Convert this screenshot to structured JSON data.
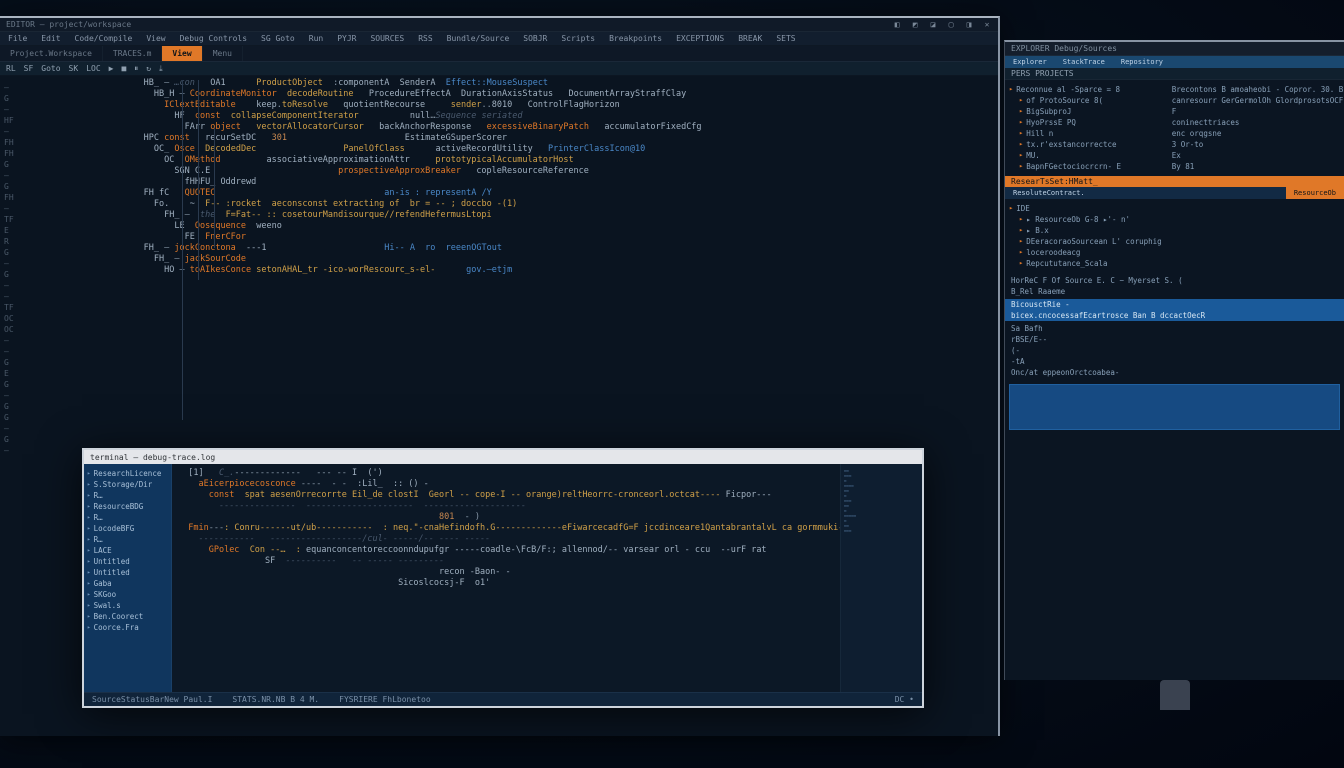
{
  "main_window": {
    "titlebar": {
      "left": "EDITOR — project/workspace"
    },
    "system_icons": [
      "◧",
      "◩",
      "◪",
      "▢",
      "◨",
      "✕"
    ],
    "menubar": [
      "File",
      "Edit",
      "Code/Compile",
      "View",
      "Debug Controls",
      "SG Goto",
      "Run",
      "PYJR",
      "SOURCES",
      "RSS",
      "Bundle/Source",
      "SOBJR",
      "Scripts",
      "Breakpoints",
      "EXCEPTIONS",
      "BREAK",
      "SETS"
    ],
    "tabs": [
      {
        "label": "Project.Workspace",
        "active": false
      },
      {
        "label": "TRACES.m",
        "active": false
      },
      {
        "label": "View",
        "active": true
      },
      {
        "label": "Menu",
        "active": false
      }
    ],
    "toolbar": [
      "RL",
      "SF",
      "Goto",
      "SK",
      "LOC",
      "▶",
      "■",
      "⏸",
      "↻",
      "⤓"
    ],
    "gutter": [
      "—",
      "G",
      "—",
      "HF",
      "—",
      "FH",
      "FH",
      "G",
      "—",
      "G",
      "FH",
      "—",
      "TF",
      "E",
      "R",
      "G",
      "—",
      "G",
      "—",
      "—",
      "TF",
      "OC",
      "OC",
      "—",
      "—",
      "G",
      "E",
      "G",
      "—",
      "G",
      "G",
      "—",
      "G",
      "—"
    ],
    "code_lines": [
      [
        [
          "id",
          "HB_"
        ],
        [
          "op",
          " — "
        ],
        [
          "cm",
          "…con"
        ],
        [
          "op",
          "   "
        ],
        [
          "id",
          "OA1"
        ],
        [
          "op",
          "      "
        ],
        [
          "fn",
          "ProductObject"
        ],
        [
          "op",
          "  :"
        ],
        [
          "id",
          "componentA"
        ],
        [
          "op",
          "  "
        ],
        [
          "id",
          "SenderA"
        ],
        [
          "op",
          "  "
        ],
        [
          "typ",
          "Effect::MouseSuspect"
        ]
      ],
      [
        [
          "id",
          "HB_H"
        ],
        [
          "op",
          " — "
        ],
        [
          "kw",
          "CoordinateMonitor"
        ],
        [
          "op",
          "  "
        ],
        [
          "fn",
          "decodeRoutine"
        ],
        [
          "op",
          "   "
        ],
        [
          "id",
          "ProcedureEffectA"
        ],
        [
          "op",
          "  "
        ],
        [
          "id",
          "DurationAxisStatus"
        ],
        [
          "op",
          "   "
        ],
        [
          "id",
          "DocumentArrayStraffClay"
        ]
      ],
      [
        [
          "kw",
          "IClextEditable"
        ],
        [
          "op",
          "    "
        ],
        [
          "id",
          "keep"
        ],
        [
          "op",
          "."
        ],
        [
          "fn",
          "toResolve"
        ],
        [
          "op",
          "   "
        ],
        [
          "id",
          "quotientRecourse"
        ],
        [
          "op",
          "     "
        ],
        [
          "fn",
          "sender"
        ],
        [
          "op",
          ".."
        ],
        [
          "id",
          "8010"
        ],
        [
          "op",
          "   "
        ],
        [
          "id",
          "ControlFlagHorizon"
        ]
      ],
      [
        [
          "id",
          "HF"
        ],
        [
          "op",
          "  "
        ],
        [
          "kw",
          "const"
        ],
        [
          "op",
          "  "
        ],
        [
          "fn",
          "collapseComponentIterator"
        ],
        [
          "op",
          "          "
        ],
        [
          "id",
          "null"
        ],
        [
          "op",
          "…"
        ],
        [
          "cm",
          "Sequence seriated"
        ]
      ],
      [
        [
          "id",
          "FArr"
        ],
        [
          "op",
          " "
        ],
        [
          "kw",
          "object"
        ],
        [
          "op",
          "   "
        ],
        [
          "fn",
          "vectorAllocatorCursor"
        ],
        [
          "op",
          "   "
        ],
        [
          "id",
          "backAnchorResponse"
        ],
        [
          "op",
          "   "
        ],
        [
          "kw",
          "excessiveBinaryPatch"
        ],
        [
          "op",
          "   "
        ],
        [
          "id",
          "accumulatorFixedCfg"
        ]
      ],
      [
        [
          "id",
          "HPC"
        ],
        [
          "op",
          " "
        ],
        [
          "kw",
          "const"
        ],
        [
          "op",
          "   "
        ],
        [
          "id",
          "recurSetDC"
        ],
        [
          "op",
          "   "
        ],
        [
          "num",
          "301"
        ],
        [
          "op",
          "                       "
        ],
        [
          "id",
          "EstimateGSuperScorer"
        ]
      ],
      [
        [
          "id",
          "OC"
        ],
        [
          "op",
          "_ "
        ],
        [
          "kw",
          "Osce"
        ],
        [
          "op",
          "  "
        ],
        [
          "fn",
          "DecodedDec"
        ],
        [
          "op",
          "                 "
        ],
        [
          "fn",
          "PanelOfClass"
        ],
        [
          "op",
          "      "
        ],
        [
          "id",
          "activeRecordUtility"
        ],
        [
          "op",
          "   "
        ],
        [
          "typ",
          "PrinterClassIcon@10"
        ]
      ],
      [
        [
          "id",
          "OC"
        ],
        [
          "op",
          "  "
        ],
        [
          "kw",
          "OMethod"
        ],
        [
          "op",
          "         "
        ],
        [
          "id",
          "associativeApproximationAttr"
        ],
        [
          "op",
          "     "
        ],
        [
          "fn",
          "prototypicalAccumulatorHost"
        ]
      ],
      [
        [
          "id",
          "SGN C.E"
        ],
        [
          "op",
          "                         "
        ],
        [
          "kw",
          "prospectiveApproxBreaker"
        ],
        [
          "op",
          "   "
        ],
        [
          "id",
          "copleResourceReference"
        ]
      ],
      [
        [
          "id",
          "fHHFU_"
        ],
        [
          "op",
          " "
        ],
        [
          "id",
          "Oddrewd"
        ]
      ],
      [
        [
          "id",
          "FH fC"
        ],
        [
          "op",
          "   "
        ],
        [
          "kw",
          "QUOTEC"
        ],
        [
          "op",
          "                                 "
        ],
        [
          "typ",
          "an-is : representA /Y"
        ]
      ],
      [
        [
          "id",
          "Fo."
        ],
        [
          "op",
          "    "
        ],
        [
          "id",
          "~"
        ],
        [
          "op",
          "  "
        ],
        [
          "fn",
          "F-- :rocket  aeconsconst extracting of  br = -- ; doccbo -(1)"
        ]
      ],
      [
        [
          "id",
          "FH_"
        ],
        [
          "op",
          " — "
        ],
        [
          "cm",
          " the  "
        ],
        [
          "fn",
          "F=Fat-- :: cosetourMandisourque//refendHefermusLtopi"
        ]
      ],
      [
        [
          "id",
          "LE"
        ],
        [
          "op",
          "  "
        ],
        [
          "kw",
          "Qosequence"
        ],
        [
          "op",
          "  "
        ],
        [
          "id",
          "weeno"
        ]
      ],
      [
        [
          "id",
          "FE"
        ],
        [
          "op",
          "  "
        ],
        [
          "kw",
          "FnerCFor"
        ]
      ],
      [
        [
          "id",
          "FH_"
        ],
        [
          "op",
          " — "
        ],
        [
          "kw",
          "jockConctona"
        ],
        [
          "op",
          "  "
        ],
        [
          "id",
          "---1"
        ],
        [
          "op",
          "                       "
        ],
        [
          "typ",
          "Hi-- A  ro  reeenOGTout"
        ]
      ],
      [
        [
          "id",
          "FH_"
        ],
        [
          "op",
          " — "
        ],
        [
          "kw",
          "jackSourCode"
        ]
      ],
      [
        [
          "id",
          "HO"
        ],
        [
          "op",
          " — "
        ],
        [
          "kw",
          "toAIkesConce"
        ],
        [
          "op",
          " "
        ],
        [
          "fn",
          "setonAHAL_tr -ico-worRescourc_s-el-"
        ],
        [
          "op",
          "      "
        ],
        [
          "typ",
          "gov.—etjm"
        ]
      ]
    ]
  },
  "sub_window": {
    "title": "terminal — debug-trace.log",
    "sidebar_items": [
      "ResearchLicence",
      "S.Storage/Dir",
      "R…",
      "ResourceBDG",
      "R…",
      "LocodeBFG",
      "R…",
      "LACE",
      "Untitled",
      "Untitled",
      "Gaba",
      "SKGoo",
      "Swal.s",
      "Ben.Coorect",
      "Coorce.Fra"
    ],
    "code_lines": [
      [
        [
          "id",
          "[1]"
        ],
        [
          "op",
          "   "
        ],
        [
          "cm",
          "C_."
        ],
        [
          "op",
          "-------------   --- -- "
        ],
        [
          "id",
          "I  (')"
        ]
      ],
      [
        [
          "kw",
          "aEicerpiocecosconce"
        ],
        [
          "op",
          " ----  - - "
        ],
        [
          "id",
          " :Lil_  :: () -"
        ]
      ],
      [
        [
          "kw",
          "const"
        ],
        [
          "op",
          "  "
        ],
        [
          "fn",
          "spat aesenOrrecorrte Eil_de clostI  Georl -- cope-I -- orange)reltHeorrc-cronceorl.octcat----"
        ],
        [
          "id",
          " Ficpor---"
        ]
      ],
      [
        [
          "cm",
          "---------------  ---------------------  --------------------"
        ]
      ],
      [
        [
          "op",
          "                                         "
        ],
        [
          "num",
          "801"
        ],
        [
          "op",
          "  - )"
        ]
      ],
      [
        [
          "kw",
          "Fmin"
        ],
        [
          "op",
          "---"
        ],
        [
          "fn",
          ": Conru------ut/ub-----------  : neq.\"-cnaHefindofh.G-------------eFiwarcecadfG=F jccdinceare1QantabrantalvL ca gormmuki----"
        ]
      ],
      [
        [
          "cm",
          "-----------   ------------------/cul- -----/-- ---- -----"
        ]
      ],
      [
        [
          "kw",
          "GPolec"
        ],
        [
          "op",
          "  "
        ],
        [
          "fn",
          "Con --…  : "
        ],
        [
          "id",
          "equanconcentoreccoonndupufgr -----coadle-\\FcB/F:; allennod/-- varsear orl - ccu  --urF rat"
        ]
      ],
      [
        [
          "op",
          "         "
        ],
        [
          "id",
          "SF  "
        ],
        [
          "cm",
          "----------   -- ----- ---------"
        ]
      ],
      [
        [
          "op",
          "                                         "
        ],
        [
          "id",
          "recon -Baon- -"
        ]
      ],
      [
        [
          "op",
          "                                         "
        ],
        [
          "id",
          "Sicoslcocsj-F  o1'"
        ]
      ]
    ],
    "minimap_items": [
      "▬▬",
      "▬▬▬",
      "▬",
      "▬▬▬▬",
      "▬▬",
      "▬",
      "▬▬▬",
      "▬▬",
      "▬",
      "▬▬▬▬▬",
      "▬",
      "▬▬",
      "▬▬▬"
    ],
    "status": {
      "left": "SourceStatusBarNew Paul.I",
      "center": "STATS.NR.NB  B 4 M.",
      "center2": "FYSRIERE   FhLbonetoo",
      "right": "DC  •"
    }
  },
  "right_monitor": {
    "titlebar": "EXPLORER  Debug/Sources",
    "tabs": [
      "Explorer",
      "StackTrace",
      "Repository"
    ],
    "section1_title": "PERS  PROJECTS",
    "tree1": [
      {
        "depth": 0,
        "label": "Reconnue  al  -Sparce = 8"
      },
      {
        "depth": 1,
        "label": "of ProtoSource  8("
      },
      {
        "depth": 1,
        "label": "BigSubproJ"
      },
      {
        "depth": 1,
        "label": "HyoPrssE   PQ"
      },
      {
        "depth": 1,
        "label": "Hill n"
      },
      {
        "depth": 1,
        "label": "tx.r'exstancorrectce"
      },
      {
        "depth": 1,
        "label": "MU."
      },
      {
        "depth": 1,
        "label": "BapnFGectociocrcrn-   E"
      }
    ],
    "tree1_side": [
      "Brecontons B amoaheobi - Copror. 30. Bc",
      "canresourr GerGermolOh GlordprosotsOCF",
      "F",
      "coninecttriaces",
      "enc orqgsne",
      "3  Or-to",
      "Ex",
      "By 81"
    ],
    "hl_orange": "ResearTsSet:HMatt_",
    "section2_tabs": [
      "ResoluteContract.",
      "",
      "ResourceOb"
    ],
    "tree2": [
      {
        "depth": 0,
        "label": "IDE"
      },
      {
        "depth": 1,
        "label": "▸ ResourceOb G-8 ▸'- n'"
      },
      {
        "depth": 1,
        "label": "▸ B.x"
      },
      {
        "depth": 1,
        "label": "DEeracoraoSourcean L' coruphig"
      },
      {
        "depth": 1,
        "label": "loceroodeacg"
      },
      {
        "depth": 1,
        "label": "Repcututance_Scala"
      }
    ],
    "extra_lines": [
      "HorReC   F Of Source E. C − Myerset   S. (",
      "B_Rel   Raaeme",
      ""
    ],
    "hl_blue1": "BicousctRie -",
    "hl_blue2": "bicex.cncocessafEcartrosce Ban B dccactOecR",
    "code_below": [
      "Sa Bafh",
      "rBSE/E--",
      "(-",
      "-tA",
      "Onc/at   eppeonOrctcoabea-"
    ],
    "block_label": ""
  }
}
